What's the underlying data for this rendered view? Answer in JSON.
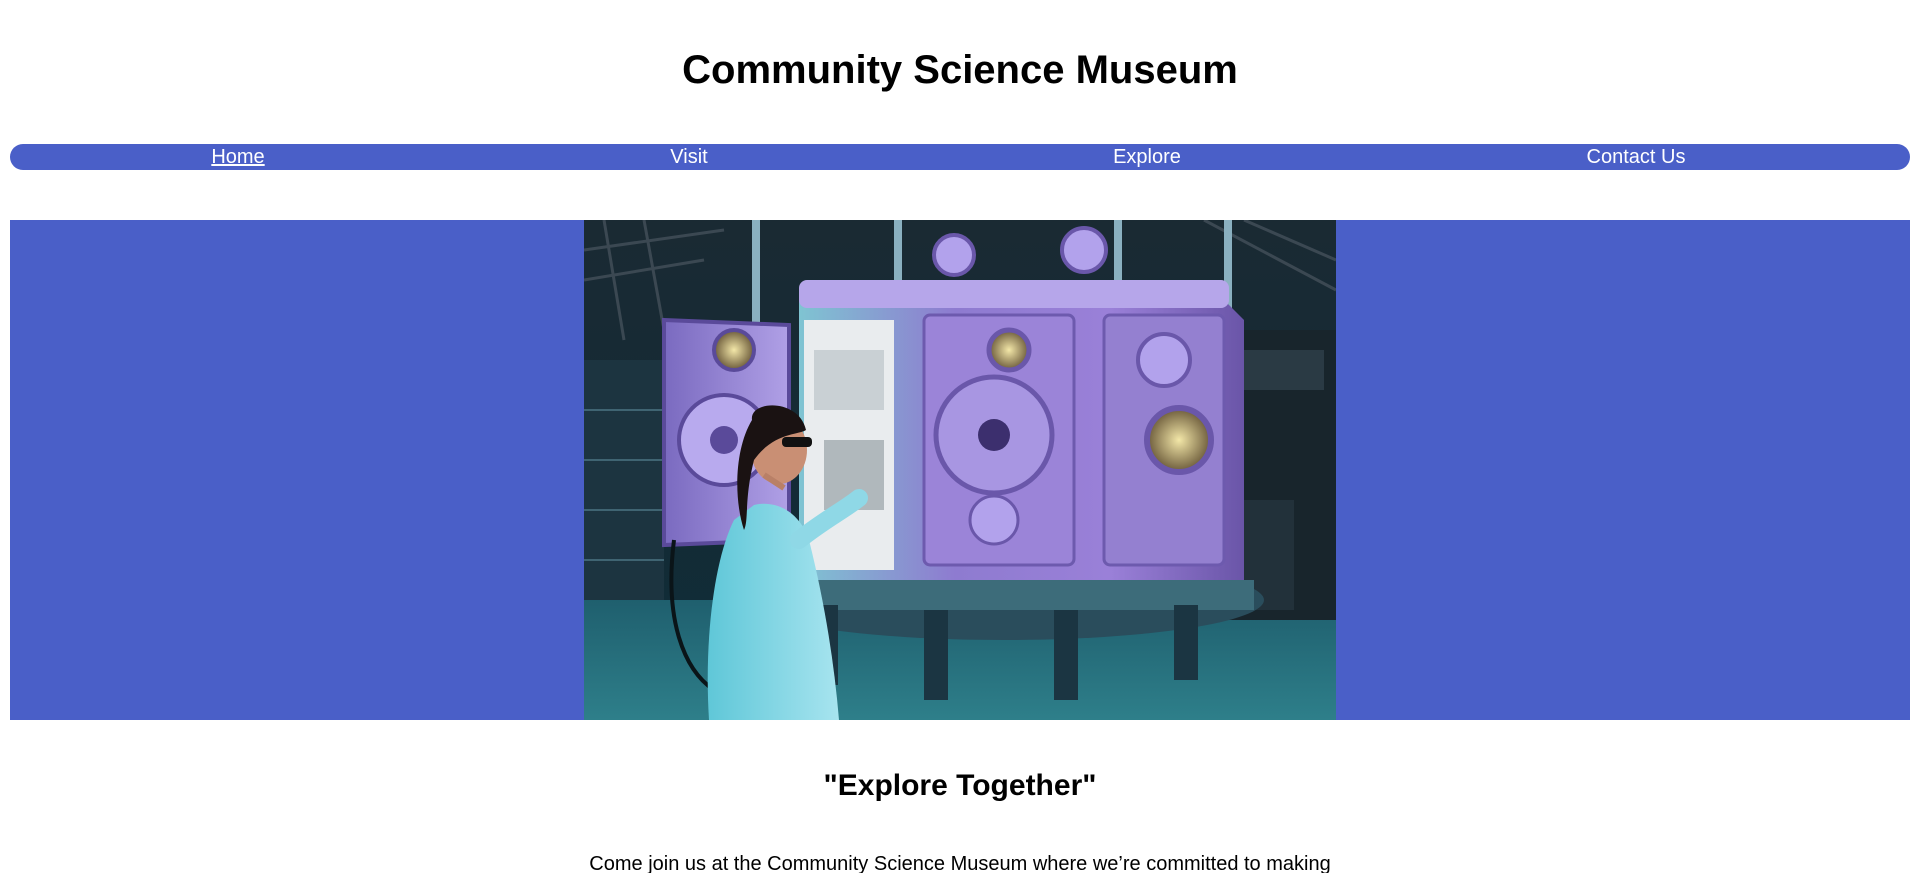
{
  "header": {
    "title": "Community Science Museum"
  },
  "nav": {
    "items": [
      {
        "label": "Home",
        "active": true
      },
      {
        "label": "Visit",
        "active": false
      },
      {
        "label": "Explore",
        "active": false
      },
      {
        "label": "Contact Us",
        "active": false
      }
    ]
  },
  "hero": {
    "image_alt": "Scientist in lab coat and safety glasses kneeling beside a large purple vacuum chamber in a laboratory",
    "background_color": "#4a5fc8"
  },
  "main": {
    "tagline": "\"Explore Together\"",
    "intro_text": "Come join us at the Community Science Museum where we’re committed to making"
  },
  "colors": {
    "nav_background": "#4a5fc8",
    "nav_text": "#ffffff",
    "text": "#000000"
  }
}
